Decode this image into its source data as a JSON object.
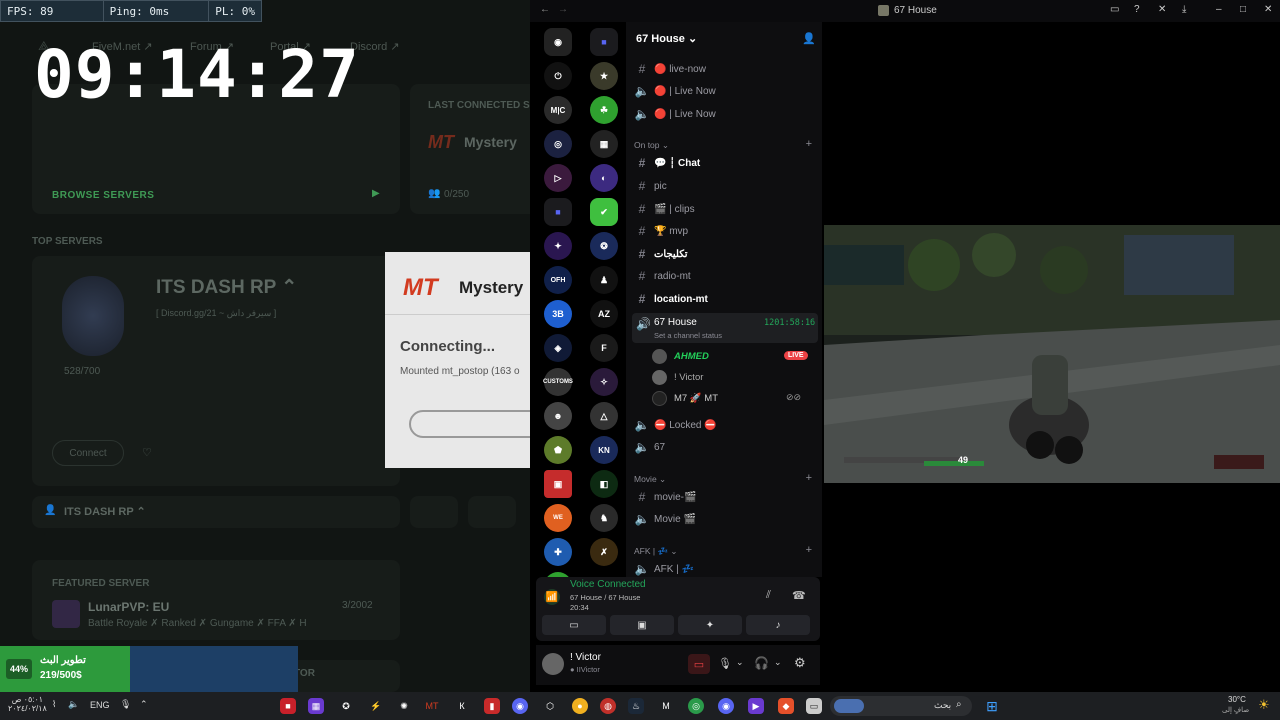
{
  "overlay": {
    "fps": "FPS: 89",
    "ping": "Ping: 0ms",
    "pl": "PL: 0%",
    "clock": "09:14:27"
  },
  "launcher": {
    "nav": [
      "FiveM.net ↗",
      "Forum ↗",
      "Portal ↗",
      "Discord ↗"
    ],
    "browse_servers": "BROWSE SERVERS",
    "last_connected": "LAST CONNECTED S",
    "last_server_name": "Mystery",
    "last_players": "0/250",
    "top_servers": "TOP SERVERS",
    "top_server_name": "ITS DASH RP ⌃",
    "top_server_sub": "[ Discord.gg/21 ~ سيرفر داش ]",
    "top_players": "528/700",
    "connect": "Connect",
    "favorite_bar_name": "ITS DASH RP ⌃",
    "featured_label": "FEATURED SERVER",
    "featured_name": "LunarPVP: EU",
    "featured_players": "3/2002",
    "featured_desc": "Battle Royale ✗ Ranked ✗ Gungame ✗ FFA ✗ H",
    "bottom_partial": "TOR"
  },
  "modal": {
    "logo": "MT",
    "title": "Mystery",
    "status": "Connecting...",
    "detail": "Mounted mt_postop (163 o"
  },
  "progress_widget": {
    "percent": "44%",
    "title": "تطوير البث",
    "value": "219/500$"
  },
  "discord": {
    "window_title": "67 House",
    "server_name": "67 House",
    "channels": [
      {
        "type": "text",
        "name": "🔴 live-now"
      },
      {
        "type": "voice",
        "name": "🔴 | Live Now"
      },
      {
        "type": "voice",
        "name": "🔴 | Live Now"
      }
    ],
    "cat_on_top": "On top",
    "on_top_channels": [
      {
        "type": "text",
        "name": "💬 ┆ Chat",
        "bold": true
      },
      {
        "type": "text",
        "name": "pic"
      },
      {
        "type": "text",
        "name": "🎬 | clips"
      },
      {
        "type": "text",
        "name": "🏆 mvp"
      },
      {
        "type": "text",
        "name": "تكليجات",
        "bold": true
      },
      {
        "type": "text",
        "name": "radio-mt"
      },
      {
        "type": "text",
        "name": "location-mt",
        "bold": true
      }
    ],
    "active_voice": {
      "name": "67 House",
      "timer": "1201:58:16",
      "status": "Set a channel status"
    },
    "voice_users": [
      {
        "name": "AHMED",
        "badge": "LIVE"
      },
      {
        "name": "! Victor"
      },
      {
        "name": "M7 🚀 MT"
      }
    ],
    "locked": "⛔ Locked ⛔",
    "ch_67": "67",
    "cat_movie": "Movie",
    "movie_channels": [
      {
        "type": "text",
        "name": "movie-🎬"
      },
      {
        "type": "voice",
        "name": "Movie 🎬"
      }
    ],
    "cat_afk": "AFK | 💤",
    "afk_channel": "AFK | 💤",
    "voice_connected": "Voice Connected",
    "voice_location": "67 House / 67 House",
    "voice_time": "20:34",
    "username": "! Victor",
    "user_tag": "● IIVictor",
    "colors": {
      "accent": "#23a55a",
      "live": "#ed4245",
      "blurple": "#5865f2"
    }
  },
  "stream_hud": {
    "speed": "49"
  },
  "taskbar": {
    "lang": "ENG",
    "clock_ar": "٠٥:٠١ ص",
    "date_ar": "٢٠٢٤/٠٢/١٨",
    "search": "بحث",
    "weather": "30°C",
    "weather_sub": "صافٍ إلى"
  }
}
